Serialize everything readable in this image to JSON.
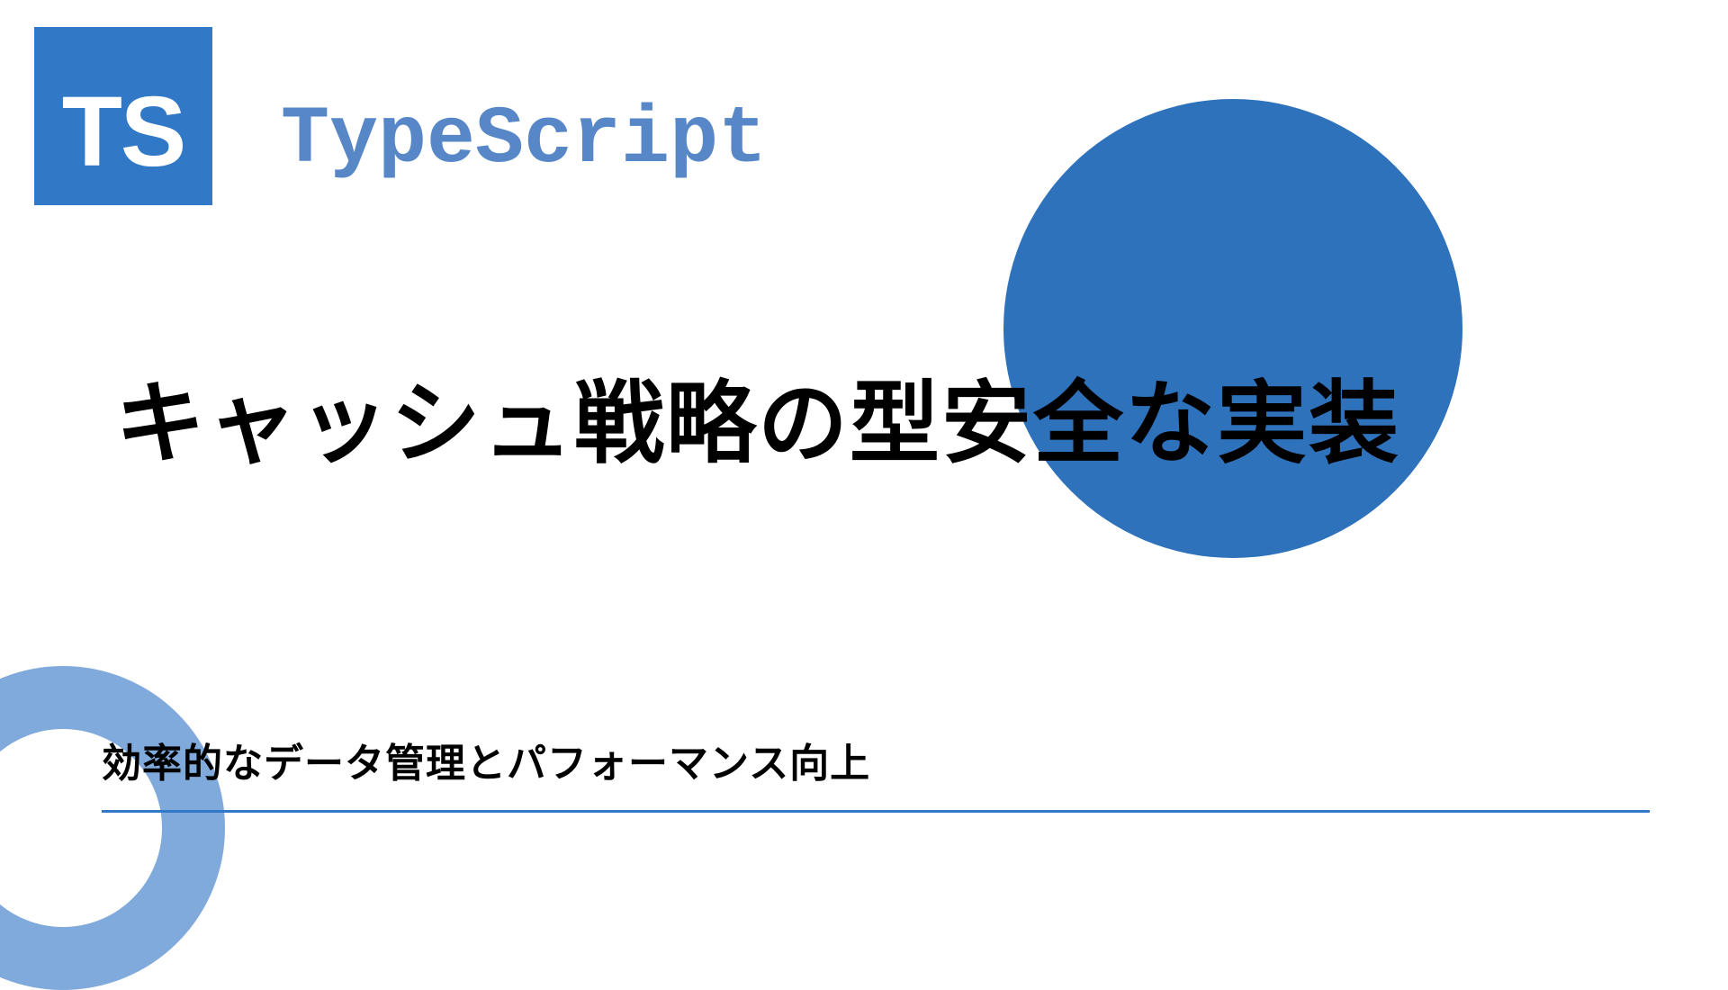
{
  "logo": {
    "text": "TS"
  },
  "brand": {
    "label": "TypeScript"
  },
  "content": {
    "title": "キャッシュ戦略の型安全な実装",
    "subtitle": "効率的なデータ管理とパフォーマンス向上"
  },
  "colors": {
    "primary": "#3178c6",
    "accent": "#2f72bc",
    "light": "#80aadc"
  }
}
